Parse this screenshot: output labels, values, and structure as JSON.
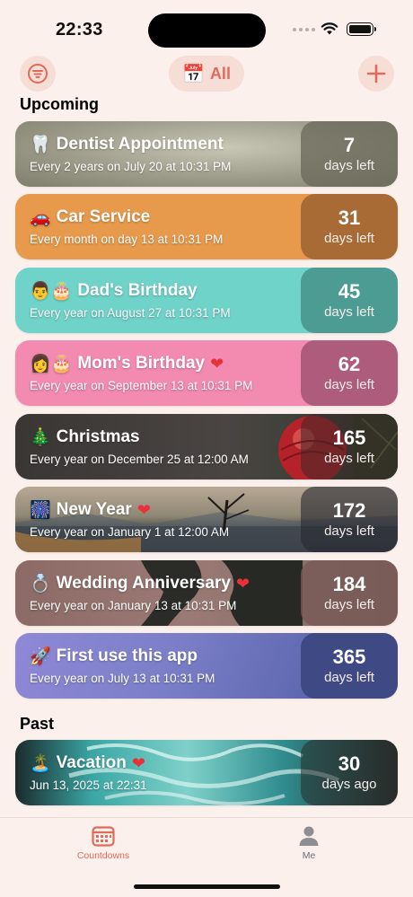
{
  "status_bar": {
    "time": "22:33"
  },
  "toolbar": {
    "filter_icon": "filter-lines-icon",
    "filter_emoji": "📅",
    "filter_label": "All",
    "add_icon": "plus-icon",
    "accent_color": "#e16a5a"
  },
  "sections": {
    "upcoming": "Upcoming",
    "past": "Past"
  },
  "cards": [
    {
      "emoji": "🦷",
      "title": "Dentist Appointment",
      "heart": false,
      "subtitle": "Every 2 years on July 20 at 10:31 PM",
      "count": "7",
      "count_label": "days left"
    },
    {
      "emoji": "🚗",
      "title": "Car Service",
      "heart": false,
      "subtitle": "Every month on day 13 at 10:31 PM",
      "count": "31",
      "count_label": "days left"
    },
    {
      "emoji": "👨🎂",
      "title": "Dad's Birthday",
      "heart": false,
      "subtitle": "Every year on August 27 at 10:31 PM",
      "count": "45",
      "count_label": "days left"
    },
    {
      "emoji": "👩🎂",
      "title": "Mom's Birthday",
      "heart": true,
      "subtitle": "Every year on September 13 at 10:31 PM",
      "count": "62",
      "count_label": "days left"
    },
    {
      "emoji": "🎄",
      "title": "Christmas",
      "heart": false,
      "subtitle": "Every year on December 25 at 12:00 AM",
      "count": "165",
      "count_label": "days left"
    },
    {
      "emoji": "🎆",
      "title": "New Year",
      "heart": true,
      "subtitle": "Every year on January 1 at 12:00 AM",
      "count": "172",
      "count_label": "days left"
    },
    {
      "emoji": "💍",
      "title": "Wedding Anniversary",
      "heart": true,
      "subtitle": "Every year on January 13 at 10:31 PM",
      "count": "184",
      "count_label": "days left"
    },
    {
      "emoji": "🚀",
      "title": "First use this app",
      "heart": false,
      "subtitle": "Every year on July 13 at 10:31 PM",
      "count": "365",
      "count_label": "days left"
    }
  ],
  "past_cards": [
    {
      "emoji": "🏝️",
      "title": "Vacation",
      "heart": true,
      "subtitle": "Jun 13, 2025 at 22:31",
      "count": "30",
      "count_label": "days ago"
    }
  ],
  "tab_bar": {
    "tabs": [
      {
        "label": "Countdowns",
        "icon": "calendar-icon",
        "active": true
      },
      {
        "label": "Me",
        "icon": "person-icon",
        "active": false
      }
    ]
  }
}
